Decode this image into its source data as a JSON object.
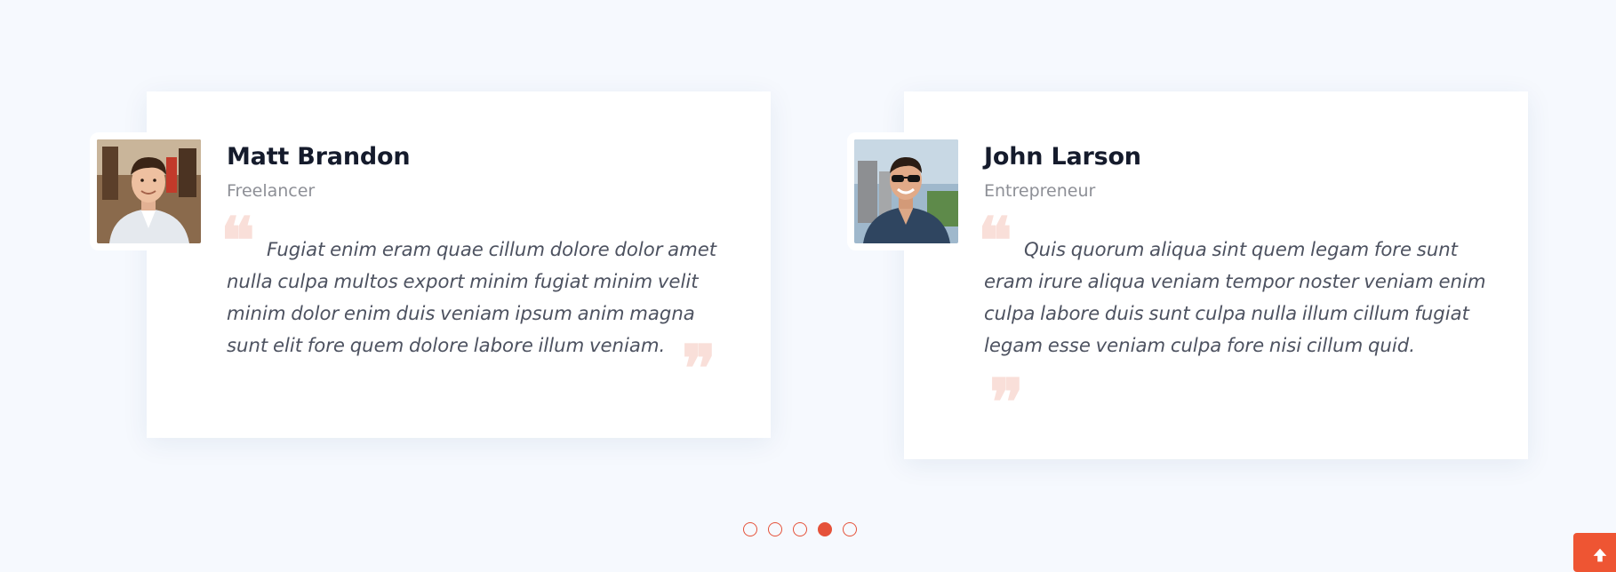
{
  "testimonials": [
    {
      "name": "Matt Brandon",
      "role": "Freelancer",
      "quote": "Fugiat enim eram quae cillum dolore dolor amet nulla culpa multos export minim fugiat minim velit minim dolor enim duis veniam ipsum anim magna sunt elit fore quem dolore labore illum veniam.",
      "avatar_icon": "person-photo-icon"
    },
    {
      "name": "John Larson",
      "role": "Entrepreneur",
      "quote": "Quis quorum aliqua sint quem legam fore sunt eram irure aliqua veniam tempor noster veniam enim culpa labore duis sunt culpa nulla illum cillum fugiat legam esse veniam culpa fore nisi cillum quid.",
      "avatar_icon": "person-photo-icon"
    }
  ],
  "quote_marks": {
    "open": "❝",
    "close": "❞"
  },
  "pagination": {
    "total": 5,
    "active_index": 4
  },
  "colors": {
    "accent": "#e5523a",
    "background": "#f6f9fe",
    "card": "#ffffff",
    "quote_mark": "#f9dfd9"
  },
  "back_to_top": {
    "icon": "arrow-up-icon"
  }
}
